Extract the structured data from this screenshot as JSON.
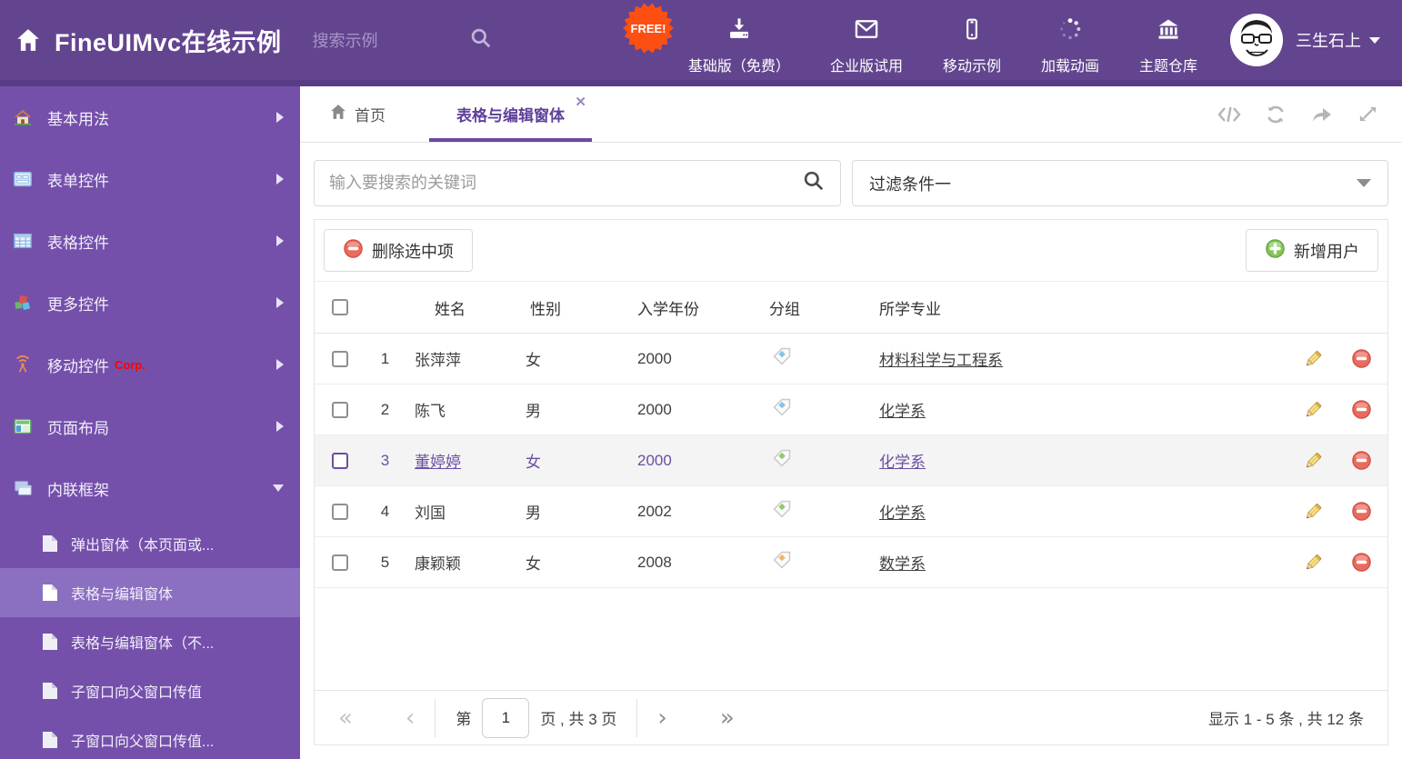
{
  "header": {
    "title": "FineUIMvc在线示例",
    "search_placeholder": "搜索示例",
    "free_badge": "FREE!",
    "nav": [
      {
        "icon": "download-icon",
        "label": "基础版（免费）"
      },
      {
        "icon": "mail-icon",
        "label": "企业版试用"
      },
      {
        "icon": "mobile-icon",
        "label": "移动示例"
      },
      {
        "icon": "spinner-icon",
        "label": "加载动画"
      },
      {
        "icon": "bank-icon",
        "label": "主题仓库"
      }
    ],
    "user": {
      "name": "三生石上"
    }
  },
  "sidebar": {
    "items": [
      {
        "icon": "home-icon",
        "label": "基本用法"
      },
      {
        "icon": "form-icon",
        "label": "表单控件"
      },
      {
        "icon": "table-icon",
        "label": "表格控件"
      },
      {
        "icon": "cubes-icon",
        "label": "更多控件"
      },
      {
        "icon": "antenna-icon",
        "label": "移动控件",
        "badge": "Corp."
      },
      {
        "icon": "layout-icon",
        "label": "页面布局"
      },
      {
        "icon": "frames-icon",
        "label": "内联框架",
        "expanded": true
      }
    ],
    "subitems": [
      {
        "label": "弹出窗体（本页面或..."
      },
      {
        "label": "表格与编辑窗体",
        "selected": true
      },
      {
        "label": "表格与编辑窗体（不..."
      },
      {
        "label": "子窗口向父窗口传值"
      },
      {
        "label": "子窗口向父窗口传值..."
      }
    ]
  },
  "tabs": [
    {
      "label": "首页",
      "icon": "home-icon"
    },
    {
      "label": "表格与编辑窗体",
      "active": true,
      "closable": true
    }
  ],
  "content": {
    "search_placeholder": "输入要搜索的关键词",
    "filter_value": "过滤条件一",
    "toolbar": {
      "delete_label": "删除选中项",
      "add_label": "新增用户"
    },
    "table": {
      "columns": {
        "name": "姓名",
        "gender": "性别",
        "year": "入学年份",
        "group": "分组",
        "major": "所学专业"
      },
      "rows": [
        {
          "num": "1",
          "name": "张萍萍",
          "gender": "女",
          "year": "2000",
          "tag_color": "#7fc3ee",
          "major": "材料科学与工程系",
          "selected": false
        },
        {
          "num": "2",
          "name": "陈飞",
          "gender": "男",
          "year": "2000",
          "tag_color": "#7fc3ee",
          "major": "化学系",
          "selected": false
        },
        {
          "num": "3",
          "name": "董婷婷",
          "gender": "女",
          "year": "2000",
          "tag_color": "#8fc96d",
          "major": "化学系",
          "selected": true
        },
        {
          "num": "4",
          "name": "刘国",
          "gender": "男",
          "year": "2002",
          "tag_color": "#8fc96d",
          "major": "化学系",
          "selected": false
        },
        {
          "num": "5",
          "name": "康颖颖",
          "gender": "女",
          "year": "2008",
          "tag_color": "#f5b26b",
          "major": "数学系",
          "selected": false
        }
      ]
    },
    "pagination": {
      "page_prefix": "第",
      "page_value": "1",
      "page_suffix": "页 , 共 3 页",
      "summary": "显示 1 - 5 条 , 共 12 条"
    }
  },
  "colors": {
    "header_bg": "#63458f",
    "header_strip": "#593c86",
    "sidebar_bg": "#7450ab",
    "sidebar_selected": "#8b6fc0",
    "accent_purple": "#6a4a9e",
    "free_badge": "#fd4f12",
    "delete_red": "#e96a5f",
    "add_green": "#86c558"
  }
}
